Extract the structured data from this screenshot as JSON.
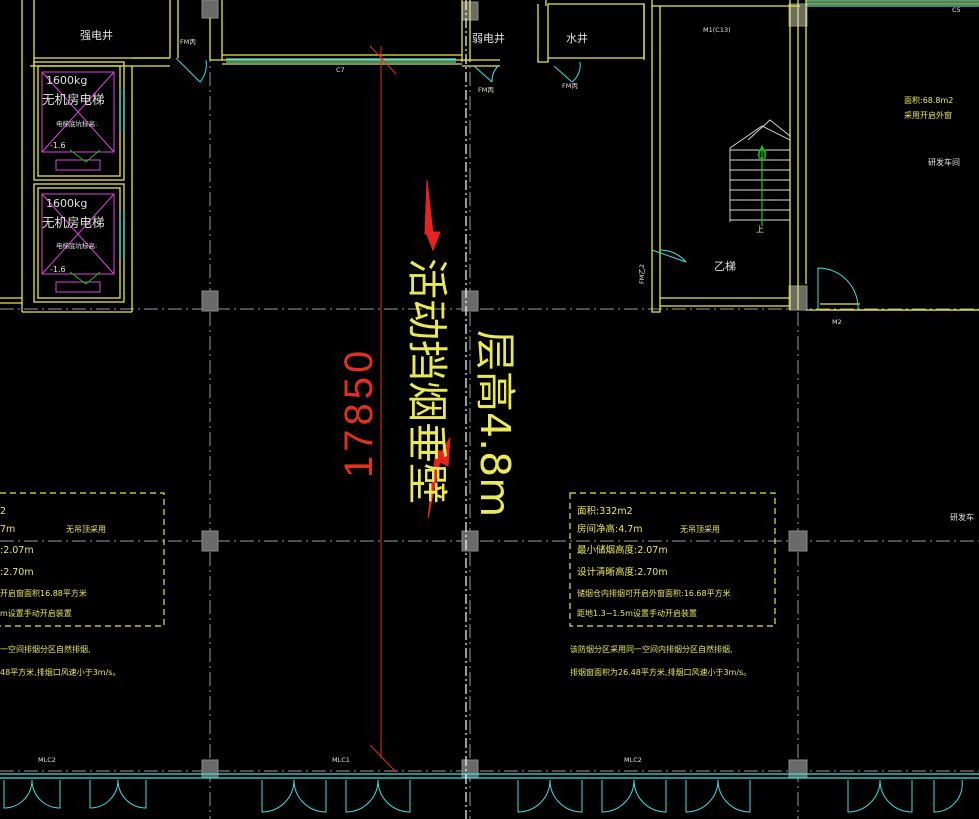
{
  "colors": {
    "background": "#000000",
    "wall": "#e8e84a",
    "glass": "#3fe0e0",
    "axis": "#9a9a9a",
    "magenta": "#e040e0",
    "dimension": "#e03020",
    "arrow": "#e52420",
    "annotation_text": "#e8e85a",
    "stair": "#20c020"
  },
  "rooms": {
    "strong_shaft": "强电井",
    "weak_shaft": "弱电井",
    "water_shaft": "水井",
    "stair_b": "乙梯",
    "stair_up": "上",
    "rd_area": "面积:68.8m2",
    "rd_open": "采用开启外窗",
    "rd_workshop": "研发车间",
    "rd_workshop_cut": "研发车"
  },
  "elevators": [
    {
      "capacity": "1600kg",
      "name": "无机房电梯",
      "note": "电梯底坑标高:",
      "level": "-1.6"
    },
    {
      "capacity": "1600kg",
      "name": "无机房电梯",
      "note": "电梯底坑标高:",
      "level": "-1.6"
    }
  ],
  "door_tags": {
    "fm_left": "FM丙",
    "fm_mid": "FM丙",
    "fm_right": "FM丙",
    "fm_stair": "FM乙2",
    "m1": "M1(C13)",
    "m2": "M2",
    "c7": "C7",
    "c5": "C5",
    "mlc_left": "MLC2",
    "mlc_center": "MLC1",
    "mlc_right": "MLC2"
  },
  "markup": {
    "dimension": "17850",
    "movable_wall": "活动挡烟垂壁",
    "floor_height": "层高4.8m"
  },
  "annotations": {
    "right": [
      "面积:332m2",
      "房间净高:4.7m",
      "无吊顶采用",
      "最小储烟高度:2.07m",
      "设计清晰高度:2.70m",
      "储烟仓内排烟可开启外窗面积:16.68平方米",
      "距地1.3~1.5m设置手动开启装置",
      "该防烟分区采用同一空间内排烟分区自然排烟,",
      "排烟窗面积为26.48平方米,排烟口风速小于3m/s。"
    ],
    "left": [
      "2",
      "7m",
      "无吊顶采用",
      ":2.07m",
      ":2.70m",
      "开启窗面积16.88平方米",
      "m设置手动开启装置",
      "一空间排烟分区自然排烟,",
      "48平方米,排烟口风速小于3m/s。"
    ]
  }
}
